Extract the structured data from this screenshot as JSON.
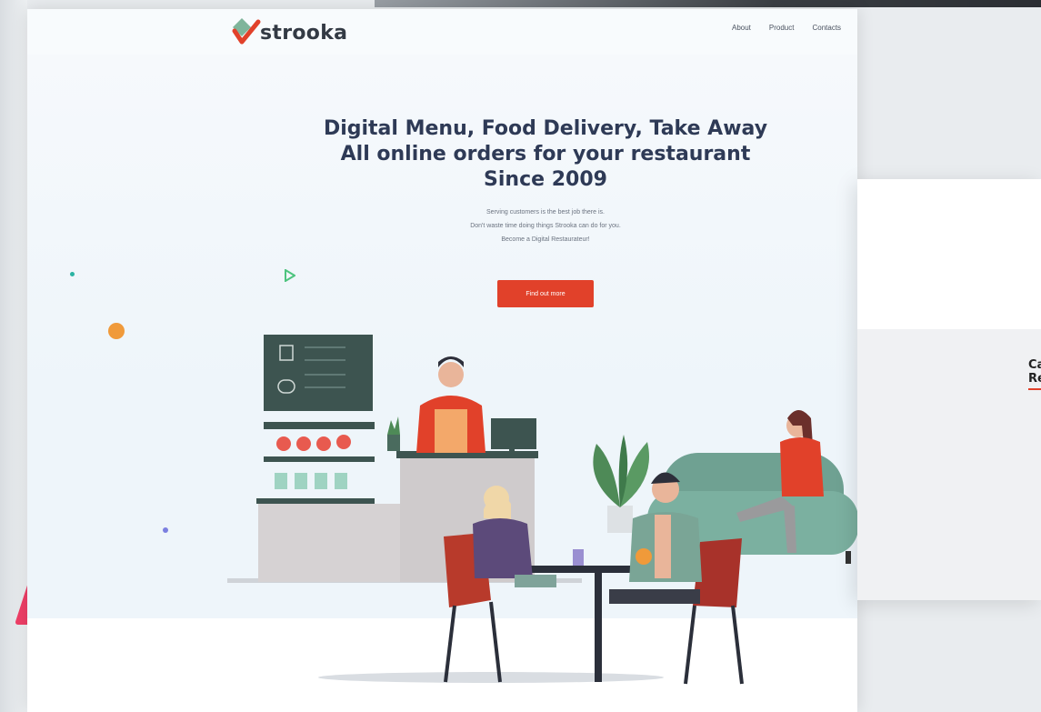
{
  "brand": {
    "name": "strooka",
    "colors": {
      "accent": "#e1412a",
      "logo_green": "#7fb59b",
      "logo_red": "#e1412a",
      "title": "#2e3a56"
    }
  },
  "nav": {
    "links": [
      "About",
      "Product",
      "Contacts"
    ]
  },
  "hero": {
    "title_lines": [
      "Digital Menu, Food Delivery, Take Away",
      "All online orders for your restaurant",
      "Since 2009"
    ],
    "subtitle_lines": [
      "Serving customers is the best job there is.",
      "Don't waste time doing things Strooka can do for you.",
      "Become a Digital Restaurateur!"
    ],
    "cta_label": "Find out more"
  },
  "side_preview": {
    "title_lines": [
      "Ca",
      "Re"
    ]
  },
  "icons": [
    "logo-diamond-check-icon",
    "play-triangle-icon"
  ]
}
